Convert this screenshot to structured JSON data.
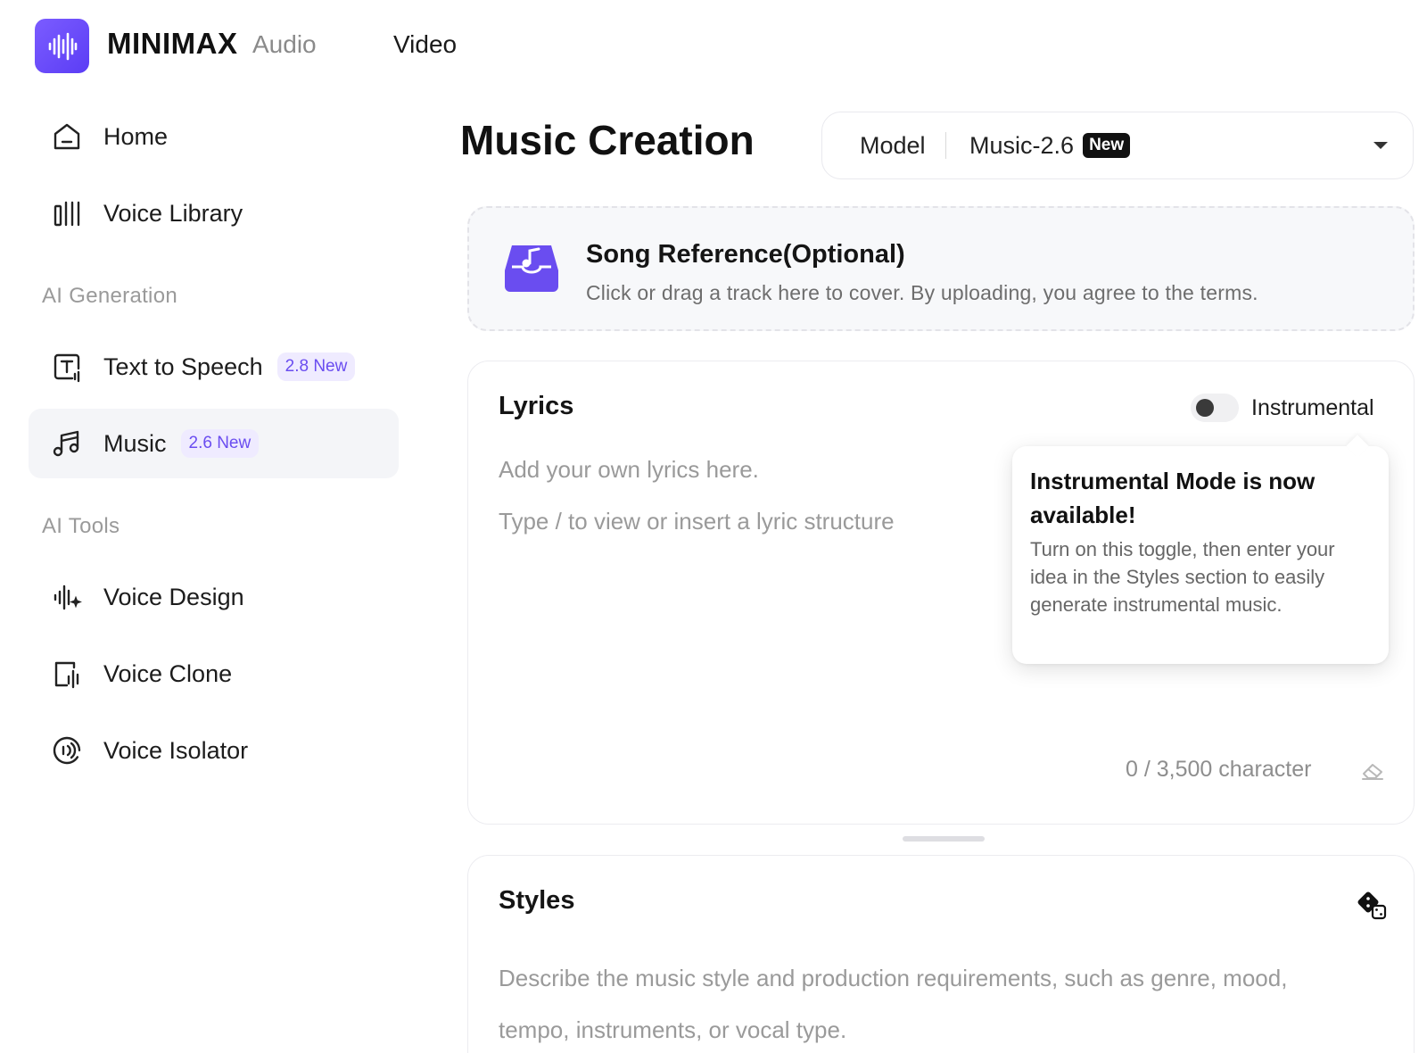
{
  "header": {
    "brand": "MINIMAX",
    "nav": [
      "Audio",
      "Video"
    ],
    "accent": "#6a4df0"
  },
  "sidebar": {
    "items_top": [
      {
        "label": "Home",
        "icon": "home-icon"
      },
      {
        "label": "Voice Library",
        "icon": "library-icon"
      }
    ],
    "section_ai_generation": "AI Generation",
    "items_generation": [
      {
        "label": "Text to Speech",
        "tag": "2.8 New",
        "icon": "text-to-speech-icon"
      },
      {
        "label": "Music",
        "tag": "2.6 New",
        "icon": "music-note-icon",
        "active": true
      }
    ],
    "section_ai_tools": "AI Tools",
    "items_tools": [
      {
        "label": "Voice Design",
        "icon": "voice-design-icon"
      },
      {
        "label": "Voice Clone",
        "icon": "voice-clone-icon"
      },
      {
        "label": "Voice Isolator",
        "icon": "voice-isolator-icon"
      }
    ]
  },
  "main": {
    "title": "Music Creation",
    "model": {
      "label": "Model",
      "value": "Music-2.6",
      "badge": "New"
    },
    "song_reference": {
      "title": "Song Reference(Optional)",
      "subtitle": "Click or drag a track here to cover. By uploading, you agree to the terms."
    },
    "lyrics": {
      "title": "Lyrics",
      "placeholder_line1": "Add your own lyrics here.",
      "placeholder_line2": "Type / to view or insert a lyric structure",
      "toggle_label": "Instrumental",
      "toggle_on": false,
      "counter": "0 / 3,500 character"
    },
    "tooltip": {
      "title": "Instrumental Mode is now available!",
      "body": "Turn on this toggle, then enter your idea in the Styles section to easily generate instrumental music."
    },
    "styles": {
      "title": "Styles",
      "placeholder": "Describe the music style and production requirements, such as genre, mood, tempo, instruments, or vocal type."
    }
  }
}
